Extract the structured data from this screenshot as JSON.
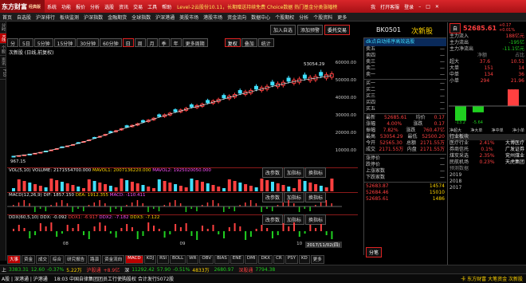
{
  "brand": {
    "name": "东方财富",
    "edition": "经典版"
  },
  "menu": [
    "系统",
    "功能",
    "报价",
    "分析",
    "选股",
    "资讯",
    "交易",
    "工具",
    "帮助",
    "文祥"
  ],
  "ticker_text": "Level-2云股份10.11，长期赠送持续免费 Choice数据 热门基金分类涨幅榜",
  "window_buttons": [
    "我",
    "打开客服",
    "登录"
  ],
  "nav": [
    "首页",
    "自选股",
    "沪深排行",
    "板块监测",
    "沪深指数",
    "金融期货",
    "全球指数",
    "沪深港通",
    "美股市场",
    "港股市场",
    "资金流向",
    "数据中心",
    "个股期权",
    "分析",
    "个股资料",
    "更多"
  ],
  "left_tabs": [
    "分时",
    "K线",
    "个股",
    "资讯",
    "F10"
  ],
  "toolbar": {
    "add_watch": "加入自选",
    "add_warning": "添加预警",
    "trade": "委托交易"
  },
  "periods": [
    "分",
    "5日",
    "5分钟",
    "15分钟",
    "30分钟",
    "60分钟",
    "日",
    "周",
    "月",
    "季",
    "年",
    "多周期",
    "更多周期"
  ],
  "toolbar2": {
    "fuquan": "复权",
    "overlay": "叠加",
    "stat": "统计",
    "more": "更多周期 ∨"
  },
  "chart": {
    "title": "次新股 (日线,前复权)",
    "high_label": "53054.29",
    "low_label": "967.15",
    "y_ticks": [
      "60000.00",
      "50000.00",
      "40000.00",
      "30000.00",
      "20000.00",
      "10000.00",
      "0.00"
    ],
    "vol_header": "VOL(5,10)  VOLUME: 2171554700.000",
    "vol_ma1": "MAVOL1: 2007136220.000",
    "vol_ma2": "MAVOL2: 1925020050.000",
    "vol_ticks": [
      "8000000.00",
      "4000000.00"
    ],
    "macd_header": "MACD(12,26,9)  DIF: 1857.150",
    "macd_dea": "DEA: 1912.355",
    "macd_val": "MACD: -110.411",
    "macd_ticks": [
      "1000.00",
      "0.00",
      "-1000.00"
    ],
    "ddx_header": "DDX(60,5,10)  DDX: -0.092",
    "ddx1": "DDX1: -6.917",
    "ddx2": "DDX2: -7.182",
    "ddx3": "DDX3: -7.122",
    "ddx_ticks": [
      "2.00",
      "0.00",
      "-2.00"
    ],
    "sub_btns": [
      "改参数",
      "加指标",
      "换指标"
    ],
    "date_label": "2017/11/02(四)",
    "month_labels": [
      "08",
      "09",
      "10"
    ]
  },
  "bottom_tabs": [
    "大事",
    "资金",
    "成交",
    "综合",
    "研究报告",
    "路演",
    "资金流向",
    "MACD",
    "KDJ",
    "RSI",
    "BOLL",
    "WR",
    "OBV",
    "BIAS",
    "ENE",
    "DMI",
    "DKX",
    "CR",
    "PSY",
    "KD",
    "更多"
  ],
  "bottom_left_tabs": [
    "指标",
    "在星"
  ],
  "quote": {
    "board": "BK0501",
    "name": "次新股",
    "promo": "dk点自动排序高效选股",
    "sells": [
      [
        "卖五",
        "—"
      ],
      [
        "卖四",
        "—"
      ],
      [
        "卖三",
        "—"
      ],
      [
        "卖二",
        "—"
      ],
      [
        "卖一",
        "—"
      ]
    ],
    "buys": [
      [
        "买一",
        "—"
      ],
      [
        "买二",
        "—"
      ],
      [
        "买三",
        "—"
      ],
      [
        "买四",
        "—"
      ],
      [
        "买五",
        "—"
      ]
    ],
    "stats": [
      [
        "最新",
        "52685.61",
        "均价",
        "0.17"
      ],
      [
        "涨幅",
        "4.00%",
        "涨跌",
        "0.17"
      ],
      [
        "振幅",
        "7.82%",
        "涨跌",
        "760.47亿"
      ],
      [
        "最高",
        "53054.29",
        "最低",
        "52500.20"
      ],
      [
        "今开",
        "52565.30",
        "总额",
        "2171.55万"
      ],
      [
        "成交",
        "2171.55万",
        "内盘",
        "2171.55万"
      ]
    ],
    "extra": [
      [
        "涨停价",
        "—"
      ],
      [
        "跌停价",
        "—"
      ],
      [
        "上涨家数",
        "—"
      ],
      [
        "下跌家数",
        "—"
      ]
    ],
    "ticks": [
      [
        "",
        "52683.87",
        "14574"
      ],
      [
        "",
        "52684.46",
        "15010"
      ],
      [
        "",
        "52685.61",
        "1486"
      ]
    ],
    "tab": "分笔"
  },
  "right": {
    "name": "次新股",
    "price": "52685.61",
    "change": "+0.17",
    "pct": "+0.01%",
    "flows": [
      [
        "主力流入",
        "188亿元"
      ],
      [
        "主力流出",
        "-195亿"
      ],
      [
        "主力净流出",
        "-11.1亿元"
      ]
    ],
    "table_header": [
      "",
      "净额",
      "占比"
    ],
    "rows": [
      [
        "超大",
        "37.6",
        "10.51"
      ],
      [
        "大单",
        "151",
        "14"
      ],
      [
        "中单",
        "134",
        "36"
      ],
      [
        "小单",
        "294",
        "21.96"
      ]
    ],
    "bars_labels": [
      "净超大",
      "净大单",
      "净中单",
      "净小单"
    ],
    "bar_values": [
      "-13.2",
      "-5.64",
      "14.9"
    ],
    "section_title": "行业板块",
    "ranks": [
      [
        "医疗行业",
        "2.41%",
        "大博医疗"
      ],
      [
        "券商信托",
        "0.1%",
        "广发证券"
      ],
      [
        "煤炭采选",
        "2.35%",
        "兖州煤业"
      ],
      [
        "民航机场",
        "0.23%",
        "天虎集团"
      ]
    ],
    "years": [
      "2019",
      "2018",
      "2017"
    ],
    "year_hdr": "预测数据"
  },
  "status": {
    "sh": "3383.31",
    "sh_ch": "12.60",
    "sh_pct": "-0.37%",
    "sh_vol": "5.22万",
    "sz": "11292.42",
    "sz_ch": "57.90",
    "sz_pct": "-0.51%",
    "sz_vol": "4833万",
    "cy": "2680.97",
    "hk_l": "沪股通",
    "hk_v": "+8.9亿",
    "sgt": "深股通",
    "sgt_v": "7794.38"
  },
  "status2": {
    "left": "A股 | 深港通 | 沪港通",
    "news": "18:03 中国自律集团团员工行使购股权  合计发行5072股",
    "time": "18:03",
    "right": "卡 东方财富  大笔资金  次新股"
  },
  "colors": {
    "up": "#ff4040",
    "down": "#20d020",
    "brand": "#d9262a"
  },
  "chart_data": {
    "type": "candlestick",
    "ylim": [
      0,
      60000
    ],
    "x": "dates",
    "values_approx_close": [
      967.15,
      2200,
      4000,
      6500,
      9000,
      12000,
      15500,
      19000,
      22000,
      25500,
      28500,
      31500,
      34000,
      37000,
      40000,
      42500,
      45000,
      47500,
      49500,
      51000,
      52685.61
    ]
  }
}
